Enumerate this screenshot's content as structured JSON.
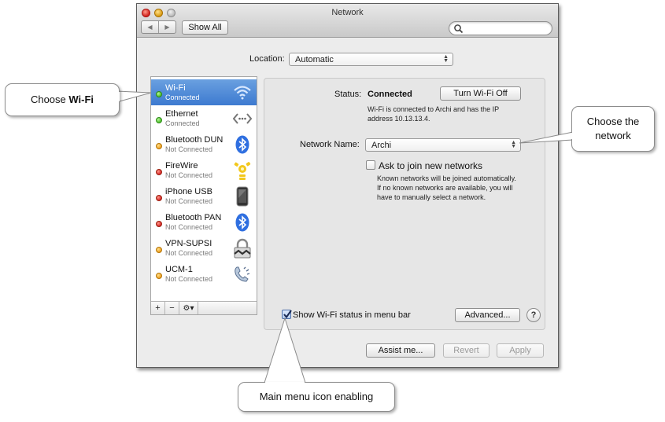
{
  "window": {
    "title": "Network",
    "show_all_label": "Show All",
    "search_placeholder": ""
  },
  "location": {
    "label": "Location:",
    "value": "Automatic"
  },
  "services": [
    {
      "name": "Wi-Fi",
      "status": "Connected",
      "dot_color": "#4cbf2a",
      "icon": "wifi-icon",
      "selected": true
    },
    {
      "name": "Ethernet",
      "status": "Connected",
      "dot_color": "#4cbf2a",
      "icon": "ethernet-icon",
      "selected": false
    },
    {
      "name": "Bluetooth DUN",
      "status": "Not Connected",
      "dot_color": "#f0a020",
      "icon": "bluetooth-icon",
      "selected": false
    },
    {
      "name": "FireWire",
      "status": "Not Connected",
      "dot_color": "#d8262a",
      "icon": "firewire-icon",
      "selected": false
    },
    {
      "name": "iPhone USB",
      "status": "Not Connected",
      "dot_color": "#d8262a",
      "icon": "iphone-icon",
      "selected": false
    },
    {
      "name": "Bluetooth PAN",
      "status": "Not Connected",
      "dot_color": "#d8262a",
      "icon": "bluetooth-icon",
      "selected": false
    },
    {
      "name": "VPN-SUPSI",
      "status": "Not Connected",
      "dot_color": "#f0a020",
      "icon": "vpn-lock-icon",
      "selected": false
    },
    {
      "name": "UCM-1",
      "status": "Not Connected",
      "dot_color": "#f0a020",
      "icon": "phone-modem-icon",
      "selected": false
    }
  ],
  "sidebar_toolbar": {
    "add": "+",
    "remove": "−",
    "gear": "⚙▾"
  },
  "detail": {
    "status_label": "Status:",
    "status_value": "Connected",
    "turn_off_label": "Turn Wi-Fi Off",
    "status_desc_line1": "Wi-Fi is connected to Archi and has the IP",
    "status_desc_line2": "address 10.13.13.4.",
    "network_name_label": "Network Name:",
    "network_name_value": "Archi",
    "ask_join_label": "Ask to join new networks",
    "ask_join_checked": false,
    "ask_join_desc_line1": "Known networks will be joined automatically.",
    "ask_join_desc_line2": "If no known networks are available, you will",
    "ask_join_desc_line3": "have to manually select a network.",
    "show_status_label": "Show Wi-Fi status in menu bar",
    "show_status_checked": true,
    "advanced_label": "Advanced...",
    "help_label": "?"
  },
  "footer": {
    "assist_label": "Assist me...",
    "revert_label": "Revert",
    "apply_label": "Apply"
  },
  "callouts": {
    "choose_wifi_prefix": "Choose ",
    "choose_wifi_bold": "Wi-Fi",
    "choose_network_line1": "Choose the",
    "choose_network_line2": "network",
    "menu_icon": "Main menu icon enabling"
  }
}
